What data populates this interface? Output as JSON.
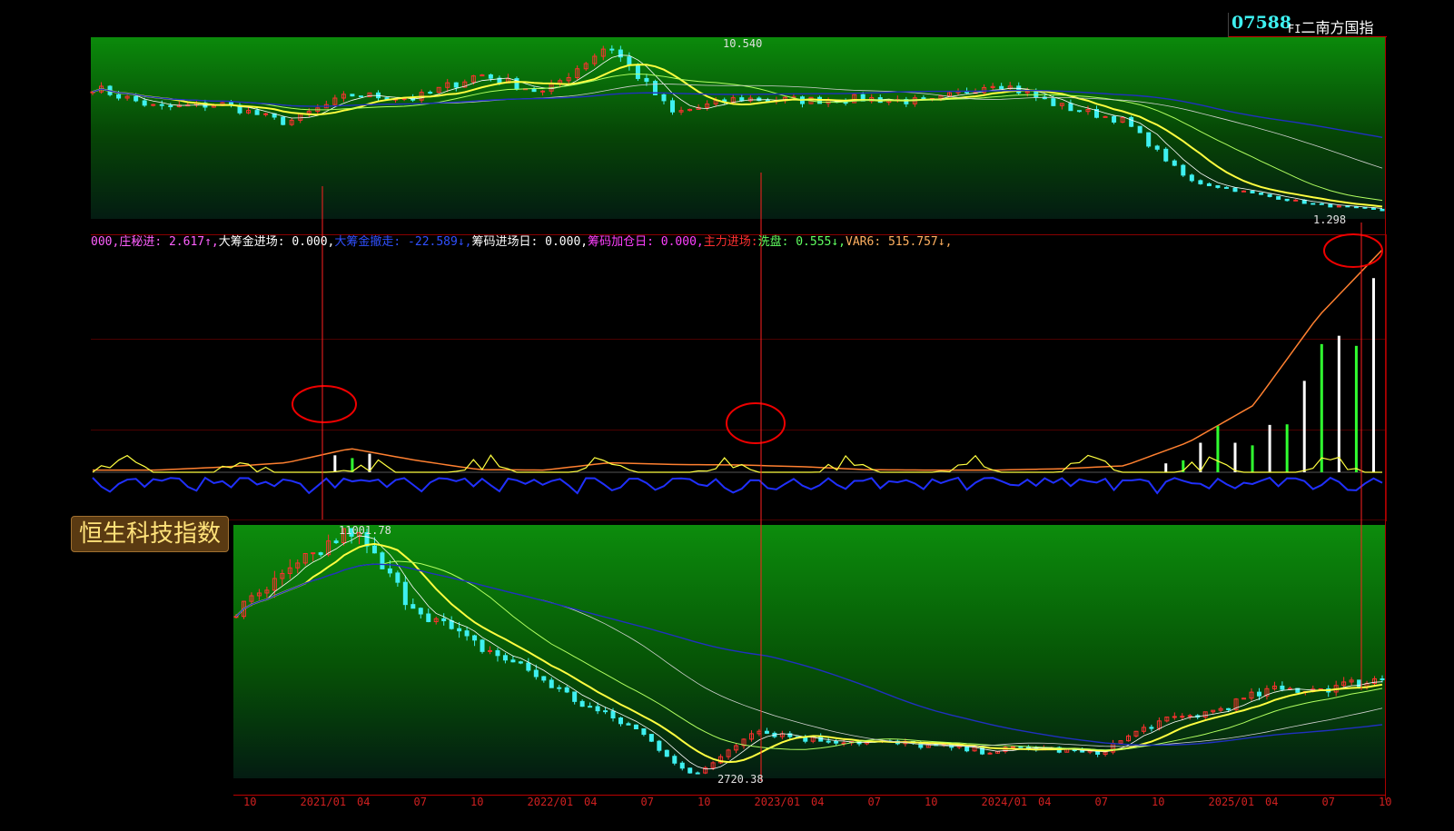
{
  "header": {
    "code": "07588",
    "prefix": "FI",
    "name": "二南方国指"
  },
  "badge": "恒生科技指数",
  "indicators": [
    {
      "label": "000,",
      "color": "#ff60ff"
    },
    {
      "label": "庄秘进: 2.617↑,",
      "color": "#ff60ff"
    },
    {
      "label": "大筹金进场: 0.000,",
      "color": "#ffffff"
    },
    {
      "label": "大筹金撤走: -22.589↓,",
      "color": "#3050ff"
    },
    {
      "label": "筹码进场日: 0.000,",
      "color": "#ffffff"
    },
    {
      "label": "筹码加仓日: 0.000,",
      "color": "#ff40ff"
    },
    {
      "label": "主力进场:",
      "color": "#ff3030"
    },
    {
      "label": "洗盘: 0.555↓,",
      "color": "#60ff60"
    },
    {
      "label": "VAR6: 515.757↓,",
      "color": "#ffb060"
    }
  ],
  "annotations": {
    "top_high": "10.540",
    "top_low": "1.298",
    "bottom_high": "11001.78",
    "bottom_low": "2720.38"
  },
  "axis_labels": [
    "10",
    "2021/01",
    "04",
    "07",
    "10",
    "2022/01",
    "04",
    "07",
    "10",
    "2023/01",
    "04",
    "07",
    "10",
    "2024/01",
    "04",
    "07",
    "10",
    "2025/01",
    "04",
    "07",
    "10"
  ],
  "colors": {
    "accent": "#3ef0f0",
    "up": "#ff3030",
    "down": "#3ef0f0",
    "ma_yellow": "#ffff40",
    "grid": "#8a0000"
  },
  "chart_data": [
    {
      "type": "line",
      "title": "07588 FI二南方国指",
      "x": [
        "2020/10",
        "2021/01",
        "2021/04",
        "2021/07",
        "2021/10",
        "2022/01",
        "2022/04",
        "2022/07",
        "2022/10",
        "2023/01",
        "2023/04",
        "2023/07",
        "2023/10",
        "2024/01",
        "2024/04",
        "2024/07",
        "2024/10",
        "2025/01",
        "2025/04",
        "2025/07",
        "2025/10"
      ],
      "series": [
        {
          "values": [
            8.2,
            7.1,
            7.3,
            6.3,
            7.8,
            7.6,
            8.9,
            7.9,
            10.5,
            6.8,
            7.6,
            7.5,
            7.6,
            7.4,
            8.5,
            7.2,
            6.4,
            3.2,
            2.5,
            1.9,
            1.6
          ]
        }
      ],
      "ylim": [
        1.298,
        10.54
      ]
    },
    {
      "type": "line",
      "title": "",
      "x": [
        "2020/10",
        "2021/01",
        "2021/04",
        "2021/07",
        "2021/10",
        "2022/01",
        "2022/04",
        "2022/07",
        "2022/10",
        "2023/01",
        "2023/04",
        "2023/07",
        "2023/10",
        "2024/01",
        "2024/04",
        "2024/07",
        "2024/10",
        "2025/01",
        "2025/04",
        "2025/07",
        "2025/10"
      ],
      "series": [
        {
          "name": "VAR6",
          "values": [
            5,
            5,
            12,
            22,
            55,
            28,
            6,
            5,
            22,
            18,
            17,
            13,
            6,
            5,
            5,
            8,
            15,
            70,
            155,
            360,
            515.757
          ]
        }
      ],
      "ylim": [
        0,
        515.757
      ]
    },
    {
      "type": "line",
      "title": "恒生科技指数",
      "x": [
        "2020/10",
        "2021/01",
        "2021/04",
        "2021/07",
        "2021/10",
        "2022/01",
        "2022/04",
        "2022/07",
        "2022/10",
        "2023/01",
        "2023/04",
        "2023/07",
        "2023/10",
        "2024/01",
        "2024/04",
        "2024/07",
        "2024/10",
        "2025/01",
        "2025/04",
        "2025/07",
        "2025/10"
      ],
      "series": [
        {
          "values": [
            8200,
            9600,
            11001.78,
            8600,
            7300,
            6400,
            5200,
            4300,
            2720.38,
            4300,
            4000,
            3900,
            3800,
            3600,
            3700,
            3500,
            4500,
            4900,
            5600,
            5700,
            6000
          ]
        }
      ],
      "ylim": [
        2720.38,
        11001.78
      ]
    }
  ]
}
